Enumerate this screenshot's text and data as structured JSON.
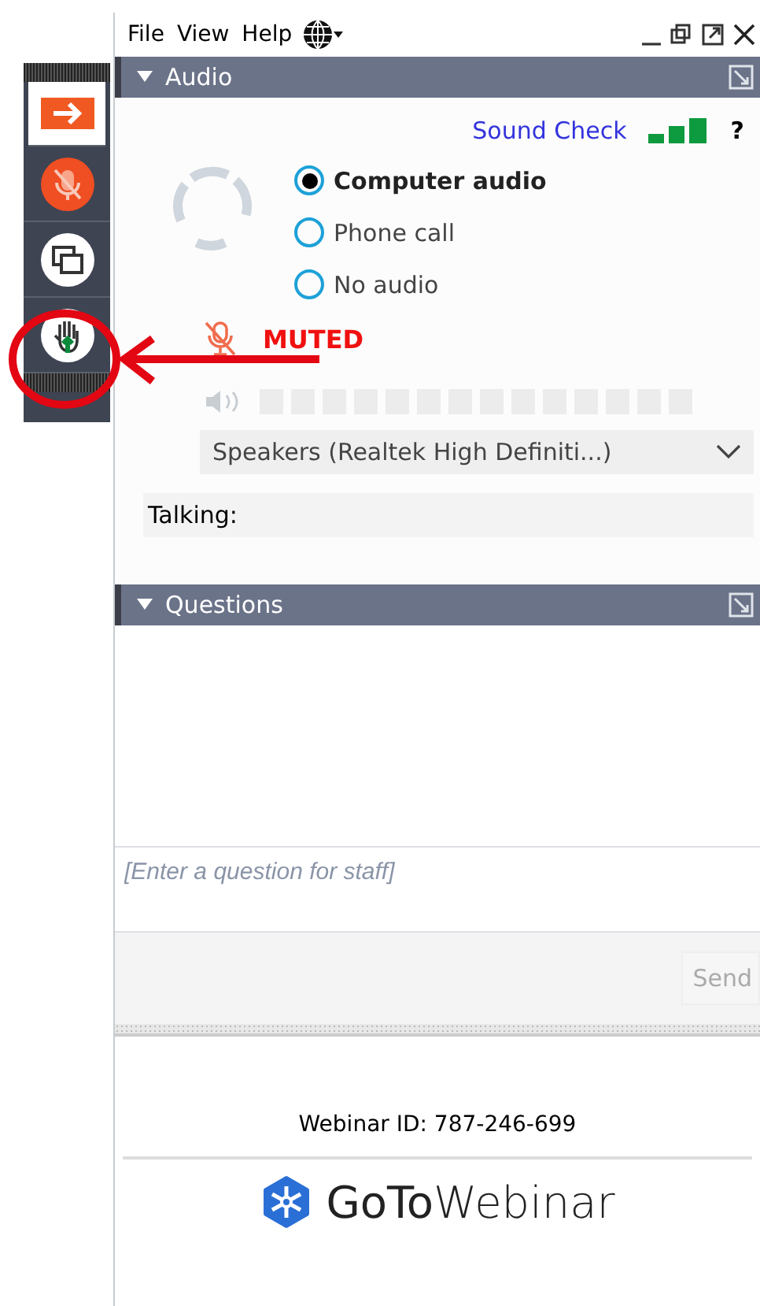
{
  "menu": [
    {
      "label": "File"
    },
    {
      "label": "View"
    },
    {
      "label": "Help"
    }
  ],
  "audio": {
    "title": "Audio",
    "sound_check": "Sound Check",
    "help": "?",
    "options": [
      {
        "label": "Computer audio",
        "selected": true
      },
      {
        "label": "Phone call",
        "selected": false
      },
      {
        "label": "No audio",
        "selected": false
      }
    ],
    "status": "MUTED",
    "device": "Speakers (Realtek High Definiti...)",
    "talking": "Talking:"
  },
  "questions": {
    "title": "Questions",
    "placeholder": "[Enter a question for staff]",
    "send": "Send"
  },
  "footer": {
    "webinar_id": "Webinar ID: 787-246-699",
    "logo": "**GoTo**Webinar"
  }
}
